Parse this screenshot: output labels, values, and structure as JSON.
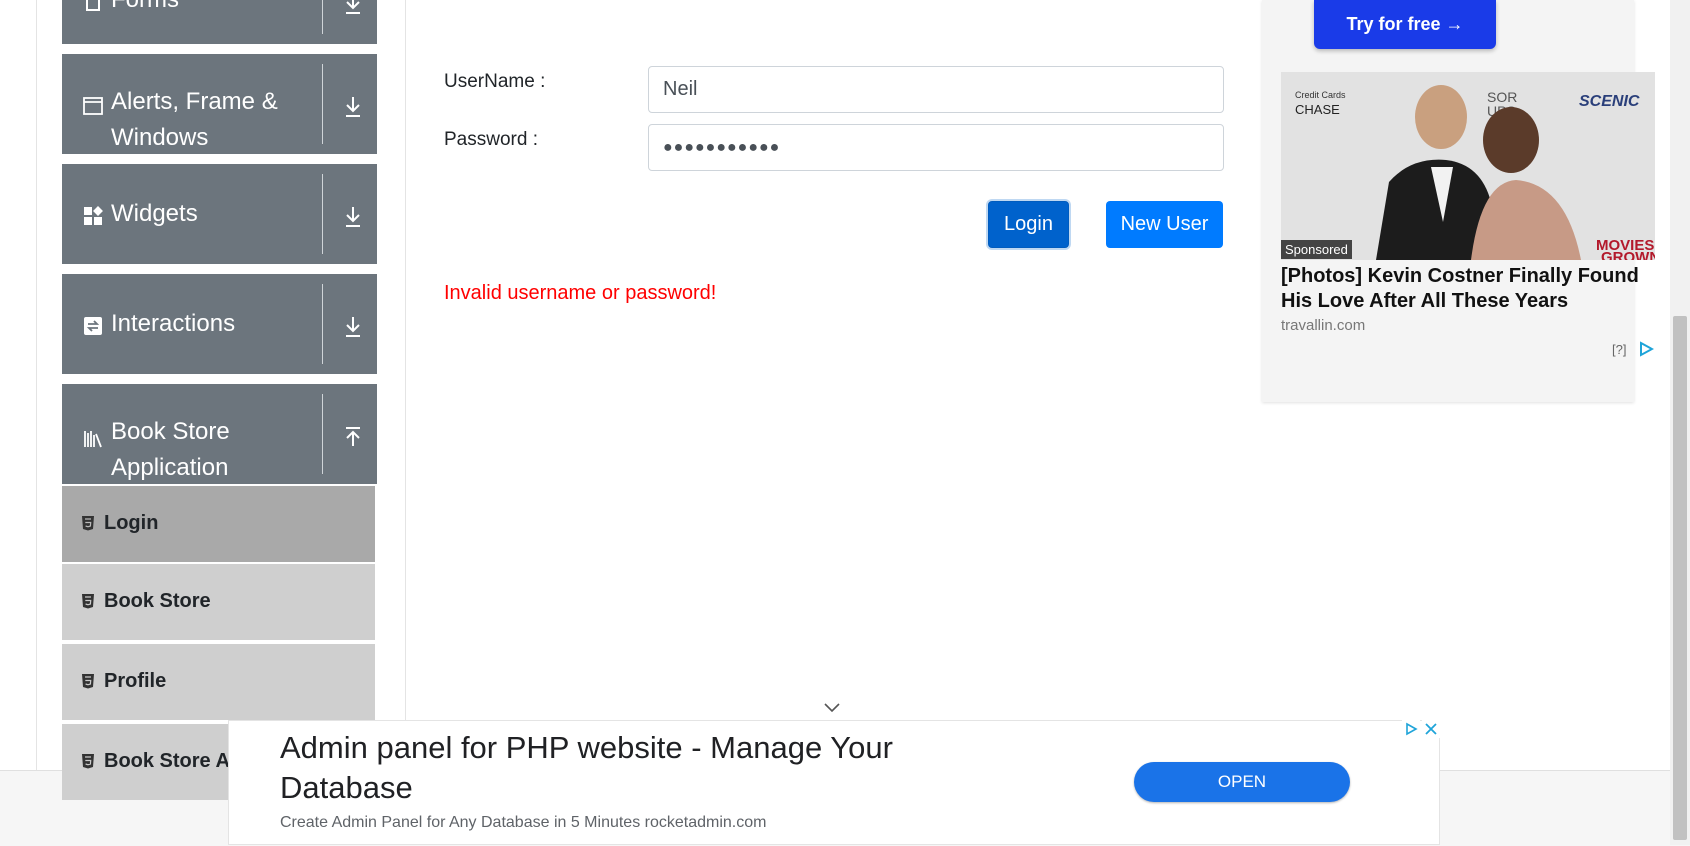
{
  "sidebar": {
    "groups": [
      {
        "label": "Forms",
        "icon": "document-icon",
        "arrow": "down"
      },
      {
        "label": "Alerts, Frame & Windows",
        "icon": "window-icon",
        "arrow": "down"
      },
      {
        "label": "Widgets",
        "icon": "widgets-icon",
        "arrow": "down"
      },
      {
        "label": "Interactions",
        "icon": "interactions-icon",
        "arrow": "down"
      },
      {
        "label": "Book Store Application",
        "icon": "books-icon",
        "arrow": "up"
      }
    ],
    "items": [
      {
        "label": "Login",
        "active": true
      },
      {
        "label": "Book Store",
        "active": false
      },
      {
        "label": "Profile",
        "active": false
      },
      {
        "label": "Book Store A",
        "active": false
      }
    ]
  },
  "form": {
    "username_label": "UserName :",
    "username_value": "Neil",
    "password_label": "Password :",
    "password_value": "●●●●●●●●●●●",
    "login_button": "Login",
    "new_user_button": "New User",
    "error_message": "Invalid username or password!"
  },
  "ad_right": {
    "cta": "Try for free →",
    "photo_texts": [
      "Credit Cards",
      "CHASE",
      "SCENIC",
      "SOR",
      "UPS",
      "MOVIES",
      "GROWN"
    ],
    "sponsored": "Sponsored",
    "headline": "[Photos] Kevin Costner Finally Found His Love After All These Years",
    "domain": "travallin.com",
    "info_marker": "[?]"
  },
  "ad_bottom": {
    "title": "Admin panel for PHP website - Manage Your Database",
    "subtitle": "Create Admin Panel for Any Database in 5 Minutes rocketadmin.com",
    "open_button": "OPEN"
  },
  "colors": {
    "sidebar_group": "#6c757d",
    "sidebar_item": "#cfcfcf",
    "sidebar_item_active": "#a9a9a9",
    "primary": "#007bff",
    "error": "#ff0000"
  }
}
